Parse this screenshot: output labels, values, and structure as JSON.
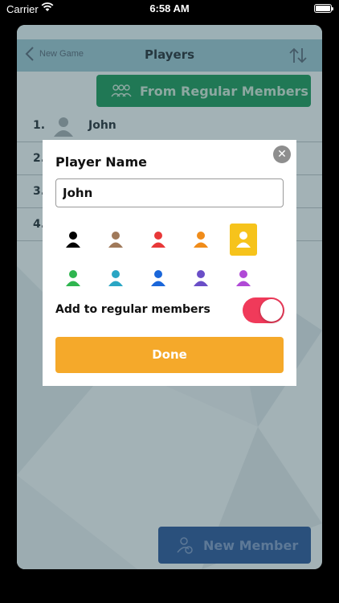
{
  "status_bar": {
    "carrier": "Carrier",
    "time": "6:58 AM"
  },
  "navbar": {
    "back_label": "New Game",
    "title": "Players"
  },
  "regular_button": {
    "label": "From Regular Members"
  },
  "players": [
    {
      "number": "1.",
      "name": "John"
    },
    {
      "number": "2.",
      "name": ""
    },
    {
      "number": "3.",
      "name": ""
    },
    {
      "number": "4.",
      "name": ""
    }
  ],
  "new_member_button": {
    "label": "New Member"
  },
  "modal": {
    "title": "Player Name",
    "input_value": "John",
    "toggle_label": "Add to regular members",
    "toggle_on": true,
    "done_label": "Done",
    "colors": [
      "#000000",
      "#a0795a",
      "#e83838",
      "#f08c1a",
      "#ffffff",
      "#2fb54f",
      "#2aa6c4",
      "#1a66d9",
      "#6a4ec7",
      "#b04ad6"
    ],
    "selected_color_index": 4
  },
  "icons": [
    "wifi-icon",
    "battery-icon",
    "back-chevron-icon",
    "sort-icon",
    "group-icon",
    "person-icon",
    "close-icon",
    "new-member-icon"
  ]
}
